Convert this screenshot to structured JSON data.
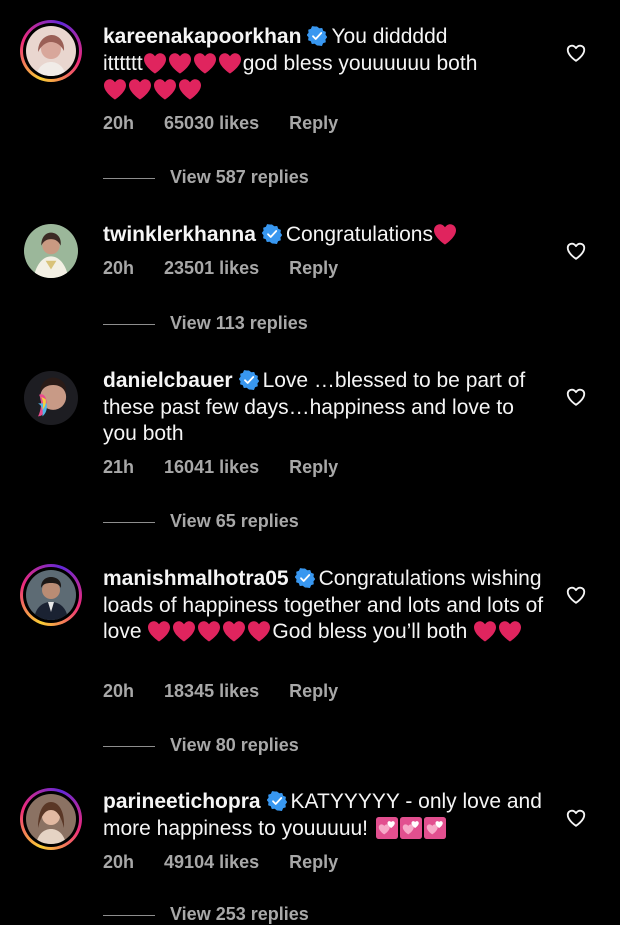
{
  "colors": {
    "background": "#000000",
    "text": "#f5f5f5",
    "muted": "#a8a8a8",
    "verified": "#3897f0",
    "heart": "#e0245e"
  },
  "comments": [
    {
      "username": "kareenakapoorkhan",
      "text_a": "You diddddd",
      "text_b": "itttttt",
      "text_c": "god bless youuuuuu both",
      "time": "20h",
      "likes": "65030 likes",
      "reply": "Reply",
      "view_replies": "View 587 replies",
      "avatar_icon": "avatar-ring"
    },
    {
      "username": "twinklerkhanna",
      "text_a": "Congratulations",
      "time": "20h",
      "likes": "23501 likes",
      "reply": "Reply",
      "view_replies": "View 113 replies",
      "avatar_icon": "avatar-plain"
    },
    {
      "username": "danielcbauer",
      "text_a": "Love …blessed to be part of these past few days…happiness and love to you both",
      "time": "21h",
      "likes": "16041 likes",
      "reply": "Reply",
      "view_replies": "View 65 replies",
      "avatar_icon": "avatar-plain"
    },
    {
      "username": "manishmalhotra05",
      "text_a": "Congratulations wishing loads of happiness together and lots and lots of love",
      "text_b": "God bless you’ll both",
      "time": "20h",
      "likes": "18345 likes",
      "reply": "Reply",
      "view_replies": "View 80 replies",
      "avatar_icon": "avatar-ring"
    },
    {
      "username": "parineetichopra",
      "text_a": "KATYYYYY - only love and more happiness to youuuuu!",
      "time": "20h",
      "likes": "49104 likes",
      "reply": "Reply",
      "view_replies": "View 253 replies",
      "avatar_icon": "avatar-ring"
    }
  ]
}
